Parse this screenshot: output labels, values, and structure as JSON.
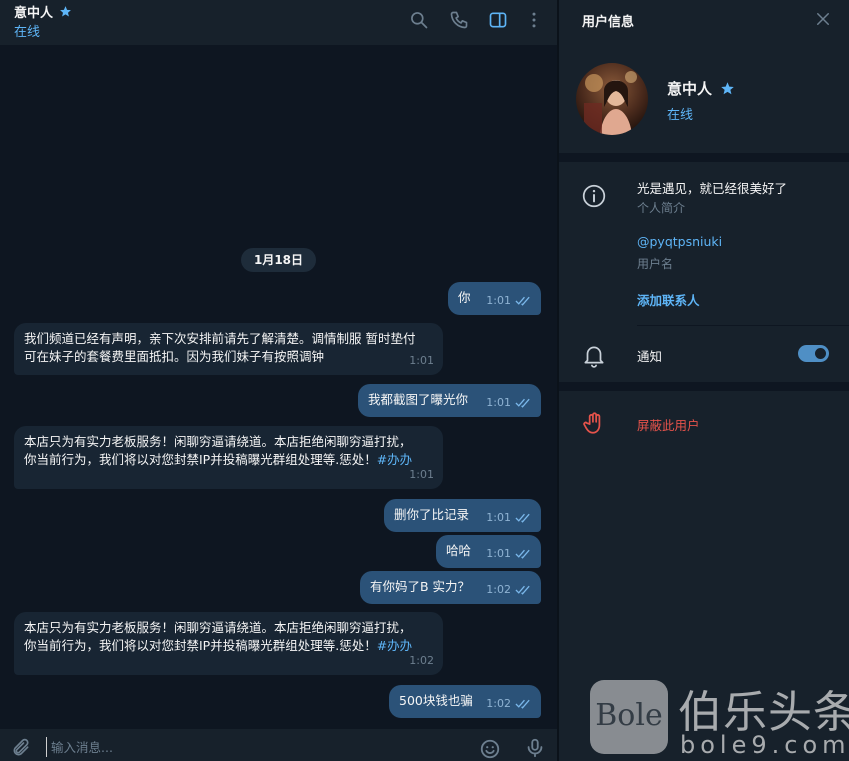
{
  "chat": {
    "title": "意中人",
    "status": "在线",
    "date_separator": "1月18日",
    "messages": [
      {
        "side": "out",
        "text": "你",
        "time": "1:01"
      },
      {
        "side": "in",
        "text": "我们频道已经有声明，亲下次安排前请先了解清楚。调情制服 暂时垫付\n可在妹子的套餐费里面抵扣。因为我们妹子有按照调钟",
        "time": "1:01"
      },
      {
        "side": "out",
        "text": "我都截图了曝光你",
        "time": "1:01"
      },
      {
        "side": "in",
        "text": "本店只为有实力老板服务！闲聊穷逼请绕道。本店拒绝闲聊穷逼打扰，\n你当前行为，我们将以对您封禁IP并投稿曝光群组处理等.惩处！",
        "hashtag": "#办办",
        "time": "1:01"
      },
      {
        "side": "out",
        "text": "删你了比记录",
        "time": "1:01"
      },
      {
        "side": "out",
        "text": "哈哈",
        "time": "1:01"
      },
      {
        "side": "out",
        "text": "有你妈了B 实力？",
        "time": "1:02"
      },
      {
        "side": "in",
        "text": "本店只为有实力老板服务！闲聊穷逼请绕道。本店拒绝闲聊穷逼打扰，\n你当前行为，我们将以对您封禁IP并投稿曝光群组处理等.惩处！",
        "hashtag": "#办办",
        "time": "1:02"
      },
      {
        "side": "out",
        "text": "500块钱也骗",
        "time": "1:02"
      }
    ],
    "composer_placeholder": "输入消息..."
  },
  "info_panel": {
    "title": "用户信息",
    "name": "意中人",
    "status": "在线",
    "bio": "光是遇见，就已经很美好了",
    "bio_label": "个人简介",
    "username": "@pyqtpsniuki",
    "username_label": "用户名",
    "add_contact": "添加联系人",
    "notifications_label": "通知",
    "notifications_on": true,
    "block_label": "屏蔽此用户"
  },
  "watermark": {
    "logo_text": "Bole",
    "brand": "伯乐头条",
    "url": "bole9.com"
  },
  "colors": {
    "accent": "#5eb5f7",
    "out_bubble": "#2b5278",
    "in_bubble": "#182533",
    "danger": "#e5534b"
  }
}
